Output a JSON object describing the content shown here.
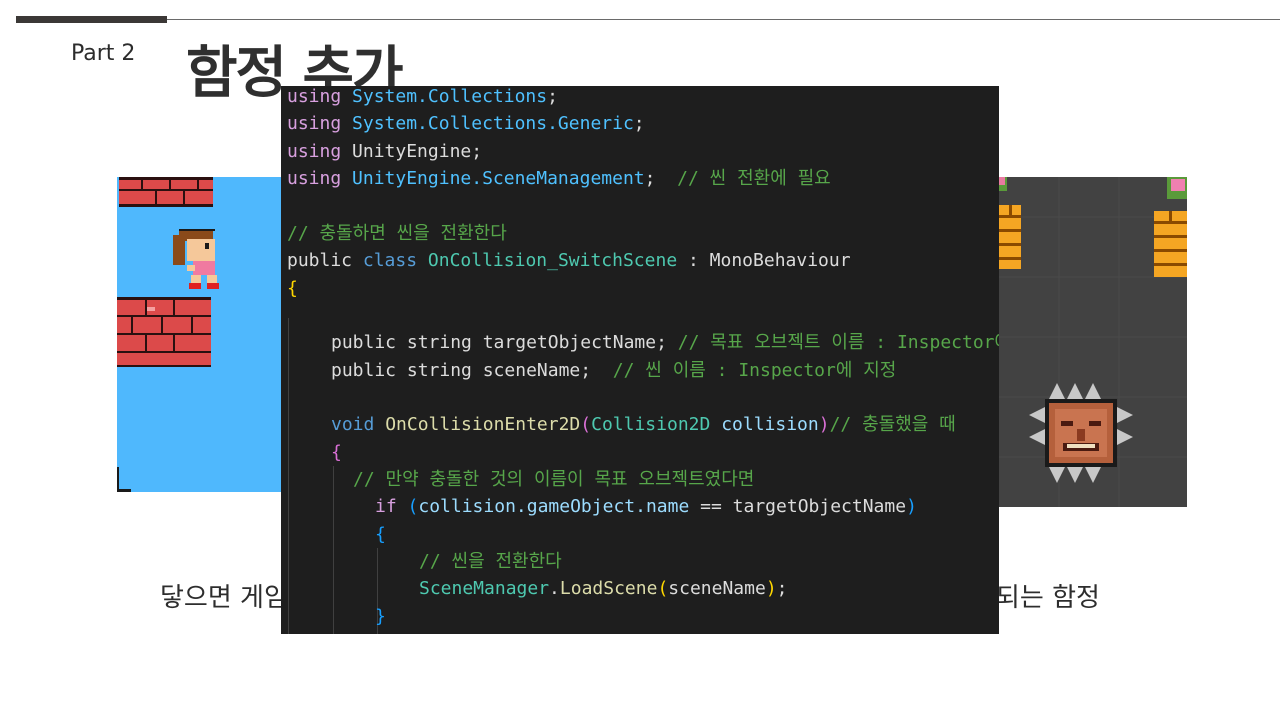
{
  "slide": {
    "part_label": "Part 2",
    "title": "함정 추가",
    "caption_left": "닿으면 게임",
    "caption_right": "되는 함정"
  },
  "code": {
    "line1": {
      "kw": "using",
      "rest": "System.Collections",
      "end": ";"
    },
    "line2": {
      "kw": "using",
      "rest": "System.Collections.Generic",
      "end": ";"
    },
    "line3": {
      "kw": "using",
      "rest": "UnityEngine",
      "end": ";"
    },
    "line4": {
      "kw": "using",
      "rest": "UnityEngine.SceneManagement",
      "end": ";",
      "comment": "// 씬 전환에 필요"
    },
    "line6": {
      "comment": "// 충돌하면 씬을 전환한다"
    },
    "line7": {
      "kw1": "public",
      "kw2": "class",
      "name": "OnCollision_SwitchScene",
      "sep": " : ",
      "base": "MonoBehaviour"
    },
    "line8": {
      "brace": "{"
    },
    "line10": {
      "decl": "public string targetObjectName;",
      "comment": "// 목표 오브젝트 이름 : Inspector에 지정"
    },
    "line11": {
      "decl": "public string sceneName;",
      "comment": "// 씬 이름 : Inspector에 지정"
    },
    "line13": {
      "kw": "void",
      "fn": "OnCollisionEnter2D",
      "open": "(",
      "type": "Collision2D",
      "param": "collision",
      "close": ")",
      "comment": "// 충돌했을 때"
    },
    "line14": {
      "brace": "{"
    },
    "line15": {
      "comment": "// 만약 충돌한 것의 이름이 목표 오브젝트였다면"
    },
    "line16": {
      "kw": "if",
      "open": "(",
      "obj": "collision.gameObject.name",
      "op": " == ",
      "val": "targetObjectName",
      "close": ")"
    },
    "line17": {
      "brace": "{"
    },
    "line18": {
      "comment": "// 씬을 전환한다"
    },
    "line19": {
      "cls": "SceneManager",
      "dot": ".",
      "fn": "LoadScene",
      "open": "(",
      "arg": "sceneName",
      "close": ")",
      "end": ";"
    },
    "line20": {
      "brace": "}"
    }
  },
  "colors": {
    "panel_bg": "#1e1e1e",
    "keyword": "#d8a0df",
    "namespace": "#4fc1ff",
    "type": "#4ec9b0",
    "comment": "#57a64a",
    "function": "#dcdcaa",
    "sky": "#4fb8fd",
    "game_bg": "#424242"
  }
}
